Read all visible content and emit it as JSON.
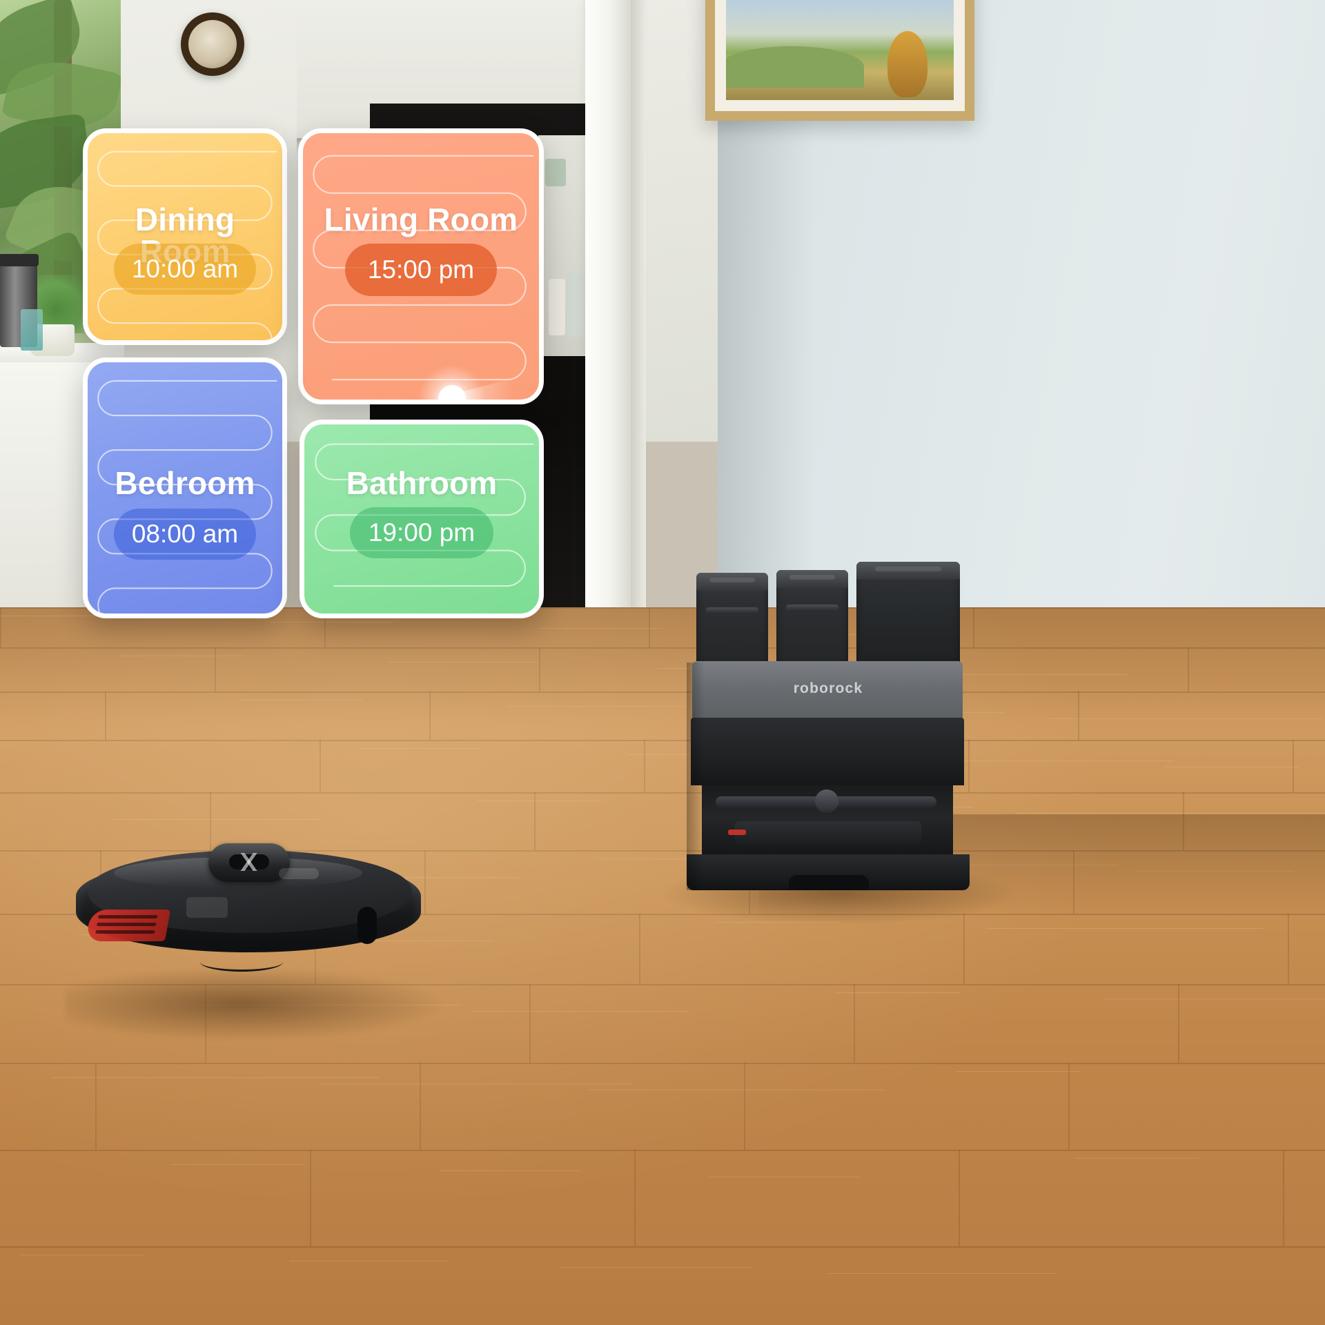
{
  "scene": {
    "product_brand": "roborock",
    "robot_vacuum_label": "robot-vacuum",
    "dock_label": "auto-empty-dock"
  },
  "overlay": {
    "cards": [
      {
        "id": "dining",
        "name": "Dining Room",
        "time": "10:00 am",
        "color": "#fbc75f",
        "pill_color": "#e8a118",
        "has_robot_marker": false
      },
      {
        "id": "living",
        "name": "Living Room",
        "time": "15:00 pm",
        "color": "#fba27f",
        "pill_color": "#e15c29",
        "has_robot_marker": true
      },
      {
        "id": "bedroom",
        "name": "Bedroom",
        "time": "08:00 am",
        "color": "#8098ee",
        "pill_color": "#2e56d6",
        "has_robot_marker": false
      },
      {
        "id": "bathroom",
        "name": "Bathroom",
        "time": "19:00 pm",
        "color": "#8ce3a0",
        "pill_color": "#26aa5c",
        "has_robot_marker": false
      }
    ],
    "robot_marker_icon": "robot-position-dot-icon"
  }
}
